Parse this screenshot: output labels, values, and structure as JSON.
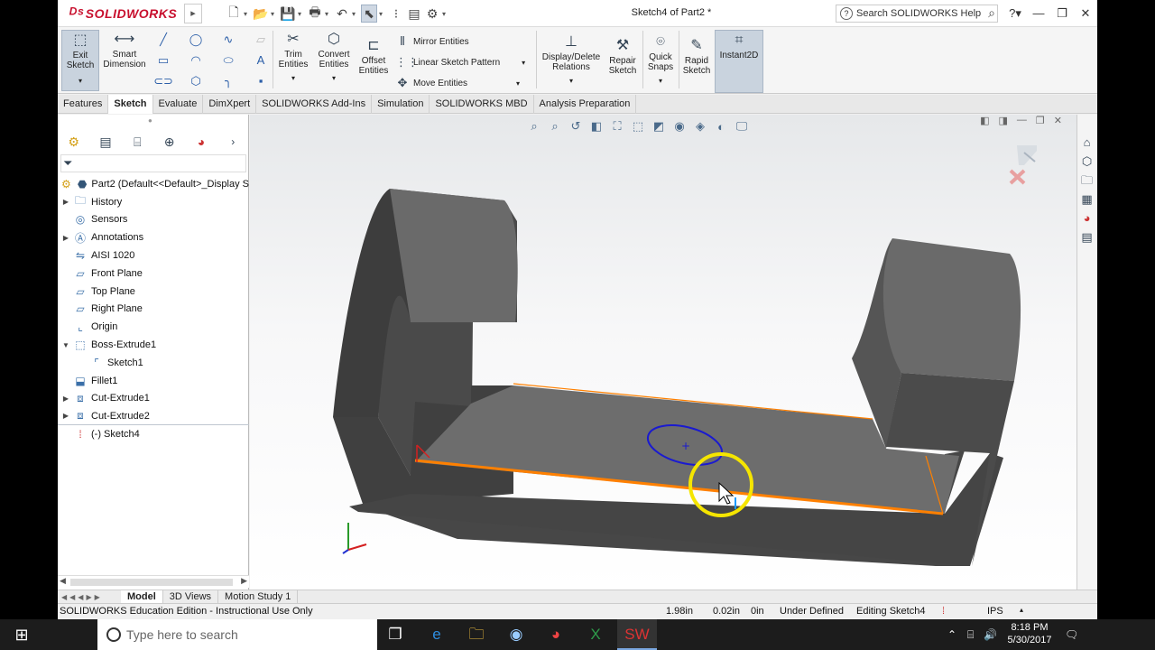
{
  "app": {
    "logo_text": "SOLIDWORKS",
    "doc_title": "Sketch4 of Part2 *",
    "help_search_placeholder": "Search SOLIDWORKS Help"
  },
  "ribbon": {
    "exit_sketch": "Exit Sketch",
    "smart_dimension": "Smart Dimension",
    "trim_entities": "Trim Entities",
    "convert_entities": "Convert Entities",
    "offset_entities": "Offset Entities",
    "mirror_entities": "Mirror Entities",
    "linear_sketch_pattern": "Linear Sketch Pattern",
    "move_entities": "Move Entities",
    "display_delete_relations": "Display/Delete Relations",
    "repair_sketch": "Repair Sketch",
    "quick_snaps": "Quick Snaps",
    "rapid_sketch": "Rapid Sketch",
    "instant2d": "Instant2D"
  },
  "tabs": [
    "Features",
    "Sketch",
    "Evaluate",
    "DimXpert",
    "SOLIDWORKS Add-Ins",
    "Simulation",
    "SOLIDWORKS MBD",
    "Analysis Preparation"
  ],
  "tree": {
    "root": "Part2  (Default<<Default>_Display S",
    "items": [
      {
        "label": "History"
      },
      {
        "label": "Sensors"
      },
      {
        "label": "Annotations"
      },
      {
        "label": "AISI 1020"
      },
      {
        "label": "Front Plane"
      },
      {
        "label": "Top Plane"
      },
      {
        "label": "Right Plane"
      },
      {
        "label": "Origin"
      },
      {
        "label": "Boss-Extrude1"
      },
      {
        "label": "Sketch1"
      },
      {
        "label": "Fillet1"
      },
      {
        "label": "Cut-Extrude1"
      },
      {
        "label": "Cut-Extrude2"
      },
      {
        "label": "(-) Sketch4"
      }
    ]
  },
  "bottom_tabs": [
    "Model",
    "3D Views",
    "Motion Study 1"
  ],
  "status": {
    "edition": "SOLIDWORKS Education Edition - Instructional Use Only",
    "x": "1.98in",
    "y": "0.02in",
    "z": "0in",
    "state": "Under Defined",
    "editing": "Editing Sketch4",
    "units": "IPS"
  },
  "taskbar": {
    "search_placeholder": "Type here to search",
    "time": "8:18 PM",
    "date": "5/30/2017"
  },
  "colors": {
    "model_gray": "#5a5a5a",
    "edge_highlight": "#ff8000",
    "sketch_ellipse": "#1a1ad0",
    "cursor_ring": "#f5e500"
  }
}
